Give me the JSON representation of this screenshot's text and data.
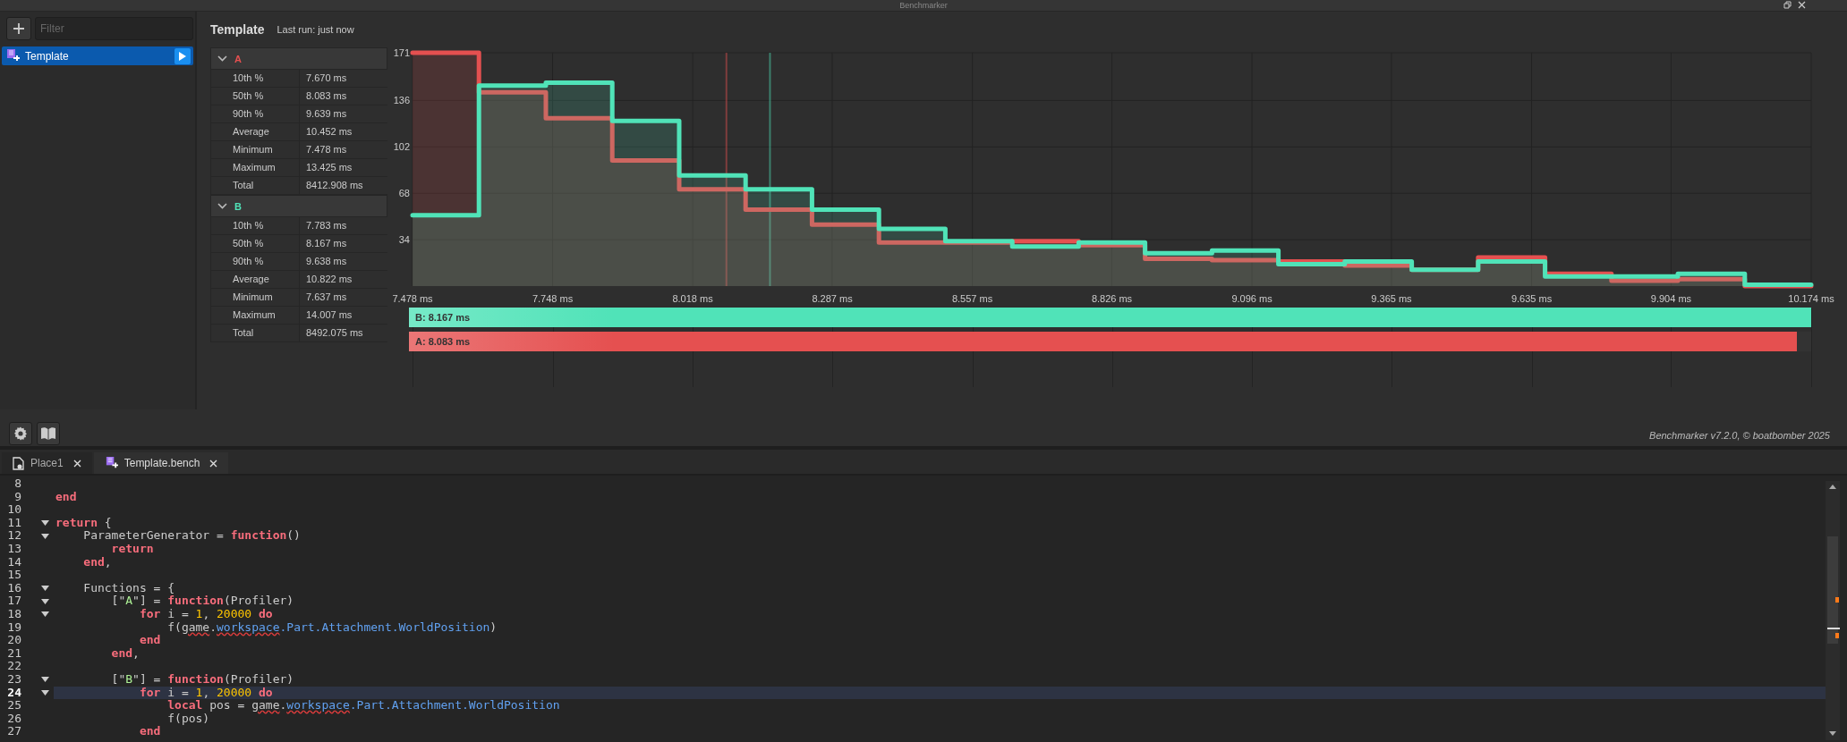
{
  "window": {
    "title": "Benchmarker"
  },
  "sidebar": {
    "filter": {
      "placeholder": "Filter"
    },
    "items": [
      {
        "label": "Template",
        "selected": true
      }
    ]
  },
  "header": {
    "title": "Template",
    "last_run": "Last run: just now"
  },
  "stats": [
    {
      "name": "A",
      "color": "#e55050",
      "expanded": true,
      "rows": [
        {
          "label": "10th %",
          "value": "7.670 ms"
        },
        {
          "label": "50th %",
          "value": "8.083 ms"
        },
        {
          "label": "90th %",
          "value": "9.639 ms"
        },
        {
          "label": "Average",
          "value": "10.452 ms"
        },
        {
          "label": "Minimum",
          "value": "7.478 ms"
        },
        {
          "label": "Maximum",
          "value": "13.425 ms"
        },
        {
          "label": "Total",
          "value": "8412.908 ms"
        }
      ]
    },
    {
      "name": "B",
      "color": "#50e3b8",
      "expanded": true,
      "rows": [
        {
          "label": "10th %",
          "value": "7.783 ms"
        },
        {
          "label": "50th %",
          "value": "8.167 ms"
        },
        {
          "label": "90th %",
          "value": "9.638 ms"
        },
        {
          "label": "Average",
          "value": "10.822 ms"
        },
        {
          "label": "Minimum",
          "value": "7.637 ms"
        },
        {
          "label": "Maximum",
          "value": "14.007 ms"
        },
        {
          "label": "Total",
          "value": "8492.075 ms"
        }
      ]
    }
  ],
  "chart": {
    "chart_data": {
      "type": "area",
      "grid": true,
      "xlim": [
        7.478,
        10.174
      ],
      "ylim": [
        0,
        171
      ],
      "x": [
        7.478,
        7.606,
        7.606,
        7.735,
        7.735,
        7.863,
        7.863,
        7.992,
        7.992,
        8.12,
        8.12,
        8.248,
        8.248,
        8.377,
        8.377,
        8.505,
        8.505,
        8.634,
        8.634,
        8.762,
        8.762,
        8.89,
        8.89,
        9.019,
        9.019,
        9.147,
        9.147,
        9.275,
        9.275,
        9.404,
        9.404,
        9.532,
        9.532,
        9.661,
        9.661,
        9.789,
        9.789,
        9.917,
        9.917,
        10.046,
        10.046,
        10.174
      ],
      "series": [
        {
          "color": "#e55050",
          "values": [
            171,
            171,
            142,
            142,
            123,
            123,
            92,
            92,
            71,
            71,
            56,
            56,
            45,
            45,
            32,
            32,
            32,
            32,
            33,
            33,
            30,
            30,
            20,
            20,
            19,
            19,
            18,
            18,
            15,
            15,
            12,
            12,
            21,
            21,
            9,
            9,
            4,
            4,
            5,
            5,
            0,
            0
          ]
        },
        {
          "color": "#50e3b8",
          "values": [
            52,
            52,
            147,
            147,
            149,
            149,
            121,
            121,
            81,
            81,
            71,
            71,
            56,
            56,
            42,
            42,
            33,
            33,
            29,
            29,
            32,
            32,
            24,
            24,
            26,
            26,
            16,
            16,
            18,
            18,
            12,
            12,
            18,
            18,
            7,
            7,
            7,
            7,
            9,
            9,
            1,
            1
          ]
        }
      ],
      "xticks": [
        {
          "value": 7.478,
          "label": "7.478 ms"
        },
        {
          "value": 7.748,
          "label": "7.748 ms"
        },
        {
          "value": 8.018,
          "label": "8.018 ms"
        },
        {
          "value": 8.287,
          "label": "8.287 ms"
        },
        {
          "value": 8.557,
          "label": "8.557 ms"
        },
        {
          "value": 8.826,
          "label": "8.826 ms"
        },
        {
          "value": 9.096,
          "label": "9.096 ms"
        },
        {
          "value": 9.365,
          "label": "9.365 ms"
        },
        {
          "value": 9.635,
          "label": "9.635 ms"
        },
        {
          "value": 9.904,
          "label": "9.904 ms"
        },
        {
          "value": 10.174,
          "label": "10.174 ms"
        }
      ],
      "yticks": [
        34,
        68,
        102,
        136,
        171
      ],
      "ref_lines": [
        {
          "axis": "x",
          "value": 8.083,
          "color": "#e55050"
        },
        {
          "axis": "x",
          "value": 8.167,
          "color": "#50e3b8"
        }
      ]
    },
    "medians": [
      {
        "label": "B: 8.167 ms",
        "level": 1,
        "color": "#50e3b8"
      },
      {
        "label": "A: 8.083 ms",
        "level": 0.99,
        "color": "#e55050"
      }
    ]
  },
  "footer": "Benchmarker v7.2.0, © boatbomber 2025",
  "tabs": [
    {
      "label": "Place1",
      "kind": "place",
      "selected": false
    },
    {
      "label": "Template.bench",
      "kind": "bench",
      "selected": true
    }
  ],
  "editor": {
    "lines": [
      {
        "number": "8",
        "foldable": false,
        "current": false
      },
      {
        "number": "9",
        "foldable": false,
        "current": false,
        "tokens": [
          {
            "kind": "keyword",
            "text": "end"
          }
        ]
      },
      {
        "number": "10",
        "foldable": false,
        "current": false
      },
      {
        "number": "11",
        "foldable": true,
        "current": false,
        "tokens": [
          {
            "kind": "keyword",
            "text": "return"
          },
          {
            "kind": "plain",
            "text": " {"
          }
        ]
      },
      {
        "number": "12",
        "foldable": true,
        "current": false,
        "tokens": [
          {
            "kind": "plain",
            "text": "    ParameterGenerator = "
          },
          {
            "kind": "keyword",
            "text": "function"
          },
          {
            "kind": "plain",
            "text": "()"
          }
        ]
      },
      {
        "number": "13",
        "foldable": false,
        "current": false,
        "tokens": [
          {
            "kind": "keyword",
            "text": "        return"
          }
        ]
      },
      {
        "number": "14",
        "foldable": false,
        "current": false,
        "tokens": [
          {
            "kind": "keyword",
            "text": "    end"
          },
          {
            "kind": "plain",
            "text": ","
          }
        ]
      },
      {
        "number": "15",
        "foldable": false,
        "current": false
      },
      {
        "number": "16",
        "foldable": true,
        "current": false,
        "tokens": [
          {
            "kind": "plain",
            "text": "    Functions = {"
          }
        ]
      },
      {
        "number": "17",
        "foldable": true,
        "current": false,
        "tokens": [
          {
            "kind": "plain",
            "text": "        [\""
          },
          {
            "kind": "string",
            "text": "A"
          },
          {
            "kind": "plain",
            "text": "\"] = "
          },
          {
            "kind": "keyword",
            "text": "function"
          },
          {
            "kind": "plain",
            "text": "(Profiler)"
          }
        ]
      },
      {
        "number": "18",
        "foldable": true,
        "current": false,
        "tokens": [
          {
            "kind": "keyword",
            "text": "            for"
          },
          {
            "kind": "plain",
            "text": " i = "
          },
          {
            "kind": "number",
            "text": "1"
          },
          {
            "kind": "plain",
            "text": ", "
          },
          {
            "kind": "number",
            "text": "20000"
          },
          {
            "kind": "keyword",
            "text": " do"
          }
        ]
      },
      {
        "number": "19",
        "foldable": false,
        "current": false,
        "tokens": [
          {
            "kind": "plain",
            "text": "                f("
          },
          {
            "kind": "global",
            "text": "game"
          },
          {
            "kind": "plain",
            "text": "."
          },
          {
            "kind": "service",
            "text": "workspace"
          },
          {
            "kind": "property",
            "text": ".Part.Attachment.WorldPosition"
          },
          {
            "kind": "plain",
            "text": ")"
          }
        ]
      },
      {
        "number": "20",
        "foldable": false,
        "current": false,
        "tokens": [
          {
            "kind": "keyword",
            "text": "            end"
          }
        ]
      },
      {
        "number": "21",
        "foldable": false,
        "current": false,
        "tokens": [
          {
            "kind": "keyword",
            "text": "        end"
          },
          {
            "kind": "plain",
            "text": ","
          }
        ]
      },
      {
        "number": "22",
        "foldable": false,
        "current": false
      },
      {
        "number": "23",
        "foldable": true,
        "current": false,
        "tokens": [
          {
            "kind": "plain",
            "text": "        [\""
          },
          {
            "kind": "string",
            "text": "B"
          },
          {
            "kind": "plain",
            "text": "\"] = "
          },
          {
            "kind": "keyword",
            "text": "function"
          },
          {
            "kind": "plain",
            "text": "(Profiler)"
          }
        ]
      },
      {
        "number": "24",
        "foldable": true,
        "current": true,
        "tokens": [
          {
            "kind": "keyword",
            "text": "            for"
          },
          {
            "kind": "plain",
            "text": " i = "
          },
          {
            "kind": "number",
            "text": "1"
          },
          {
            "kind": "plain",
            "text": ", "
          },
          {
            "kind": "number",
            "text": "20000"
          },
          {
            "kind": "keyword",
            "text": " do"
          }
        ]
      },
      {
        "number": "25",
        "foldable": false,
        "current": false,
        "tokens": [
          {
            "kind": "keyword",
            "text": "                local"
          },
          {
            "kind": "plain",
            "text": " pos = "
          },
          {
            "kind": "global",
            "text": "game"
          },
          {
            "kind": "plain",
            "text": "."
          },
          {
            "kind": "service",
            "text": "workspace"
          },
          {
            "kind": "property",
            "text": ".Part.Attachment.WorldPosition"
          }
        ]
      },
      {
        "number": "26",
        "foldable": false,
        "current": false,
        "tokens": [
          {
            "kind": "plain",
            "text": "                f(pos)"
          }
        ]
      },
      {
        "number": "27",
        "foldable": false,
        "current": false,
        "tokens": [
          {
            "kind": "keyword",
            "text": "            end"
          }
        ]
      }
    ]
  }
}
